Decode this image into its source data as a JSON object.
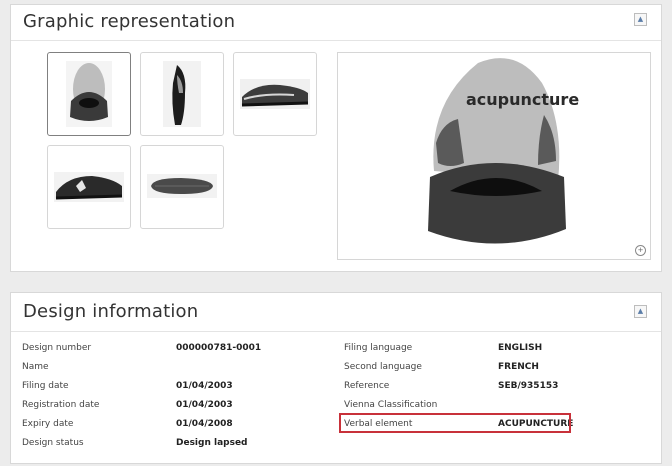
{
  "graphic": {
    "title": "Graphic representation",
    "shoe_brand": "acupuncture"
  },
  "design": {
    "title": "Design information",
    "left_rows": [
      {
        "label": "Design number",
        "value": "000000781-0001"
      },
      {
        "label": "Name",
        "value": ""
      },
      {
        "label": "Filing date",
        "value": "01/04/2003"
      },
      {
        "label": "Registration date",
        "value": "01/04/2003"
      },
      {
        "label": "Expiry date",
        "value": "01/04/2008"
      },
      {
        "label": "Design status",
        "value": "Design lapsed"
      }
    ],
    "right_rows": [
      {
        "label": "Filing language",
        "value": "ENGLISH"
      },
      {
        "label": "Second language",
        "value": "FRENCH"
      },
      {
        "label": "Reference",
        "value": "SEB/935153"
      },
      {
        "label": "Vienna Classification",
        "value": ""
      },
      {
        "label": "Verbal element",
        "value": "ACUPUNCTURE"
      }
    ]
  },
  "icons": {
    "collapse": "collapse-icon",
    "zoom": "zoom-icon"
  },
  "colors": {
    "highlight": "#c8313a"
  }
}
